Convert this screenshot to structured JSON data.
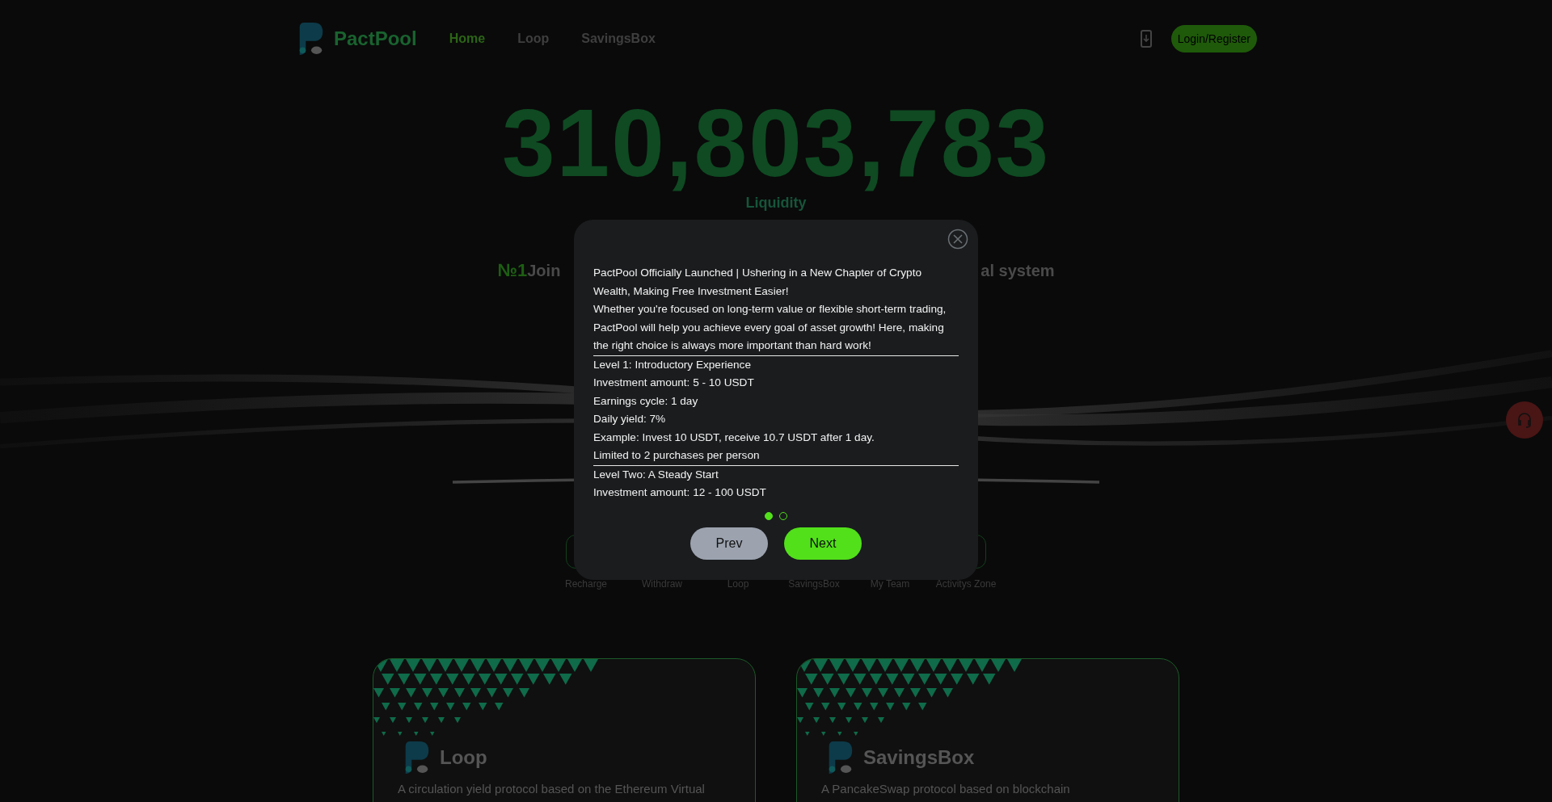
{
  "header": {
    "brand": "PactPool",
    "nav": [
      {
        "label": "Home",
        "selected": true
      },
      {
        "label": "Loop",
        "selected": false
      },
      {
        "label": "SavingsBox",
        "selected": false
      }
    ],
    "login_button": "Login/Register"
  },
  "hero": {
    "liquidity_value": "310,803,783",
    "liquidity_label": "Liquidity",
    "rank": "№1",
    "tagline_start": "Join",
    "tagline_end": "al system"
  },
  "actions": [
    "Recharge",
    "Withdraw",
    "Loop",
    "SavingsBox",
    "My Team",
    "Activitys Zone"
  ],
  "cards": [
    {
      "title": "Loop",
      "description": "A circulation yield protocol based on the Ethereum Virtual"
    },
    {
      "title": "SavingsBox",
      "description": "A PancakeSwap protocol based on blockchain"
    }
  ],
  "modal": {
    "blocks": [
      {
        "text": "PactPool Officially Launched | Ushering in a New Chapter of Crypto Wealth, Making Free Investment Easier!",
        "rule_below": false
      },
      {
        "text": "Whether you're focused on long-term value or flexible short-term trading, PactPool will help you achieve every goal of asset growth! Here, making the right choice is always more important than hard work!",
        "rule_below": true
      },
      {
        "text": "Level 1: Introductory Experience",
        "rule_below": false
      },
      {
        "text": "Investment amount: 5 - 10 USDT",
        "rule_below": false
      },
      {
        "text": "Earnings cycle: 1 day",
        "rule_below": false
      },
      {
        "text": "Daily yield: 7%",
        "rule_below": false
      },
      {
        "text": "Example: Invest 10 USDT, receive 10.7 USDT after 1 day.",
        "rule_below": false
      },
      {
        "text": "Limited to 2 purchases per person",
        "rule_below": true
      },
      {
        "text": "Level Two: A Steady Start",
        "rule_below": false
      },
      {
        "text": "Investment amount: 12 - 100 USDT",
        "rule_below": false
      }
    ],
    "dots": [
      {
        "selected": true
      },
      {
        "selected": false
      }
    ],
    "prev_button": "Prev",
    "next_button": "Next"
  }
}
